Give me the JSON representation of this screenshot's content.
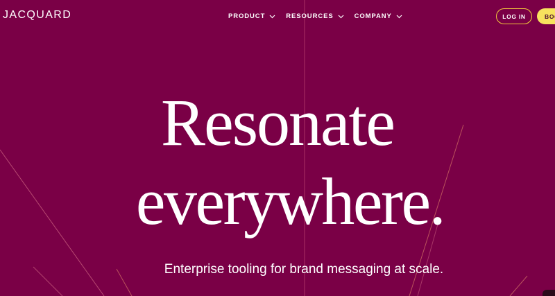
{
  "brand": {
    "logo_text": "JACQUARD",
    "background_color": "#7a0046",
    "accent_yellow": "#f7e25e",
    "outline_color": "#f1c93b"
  },
  "nav": {
    "items": [
      {
        "label": "PRODUCT",
        "icon": "chevron-down-icon"
      },
      {
        "label": "RESOURCES",
        "icon": "chevron-down-icon"
      },
      {
        "label": "COMPANY",
        "icon": "chevron-down-icon"
      }
    ],
    "login_label": "LOG IN",
    "book_label": "BOOK A DEMO"
  },
  "hero": {
    "headline_line1": "Resonate",
    "headline_line2": "everywhere.",
    "subtitle": "Enterprise tooling for brand messaging at scale."
  }
}
